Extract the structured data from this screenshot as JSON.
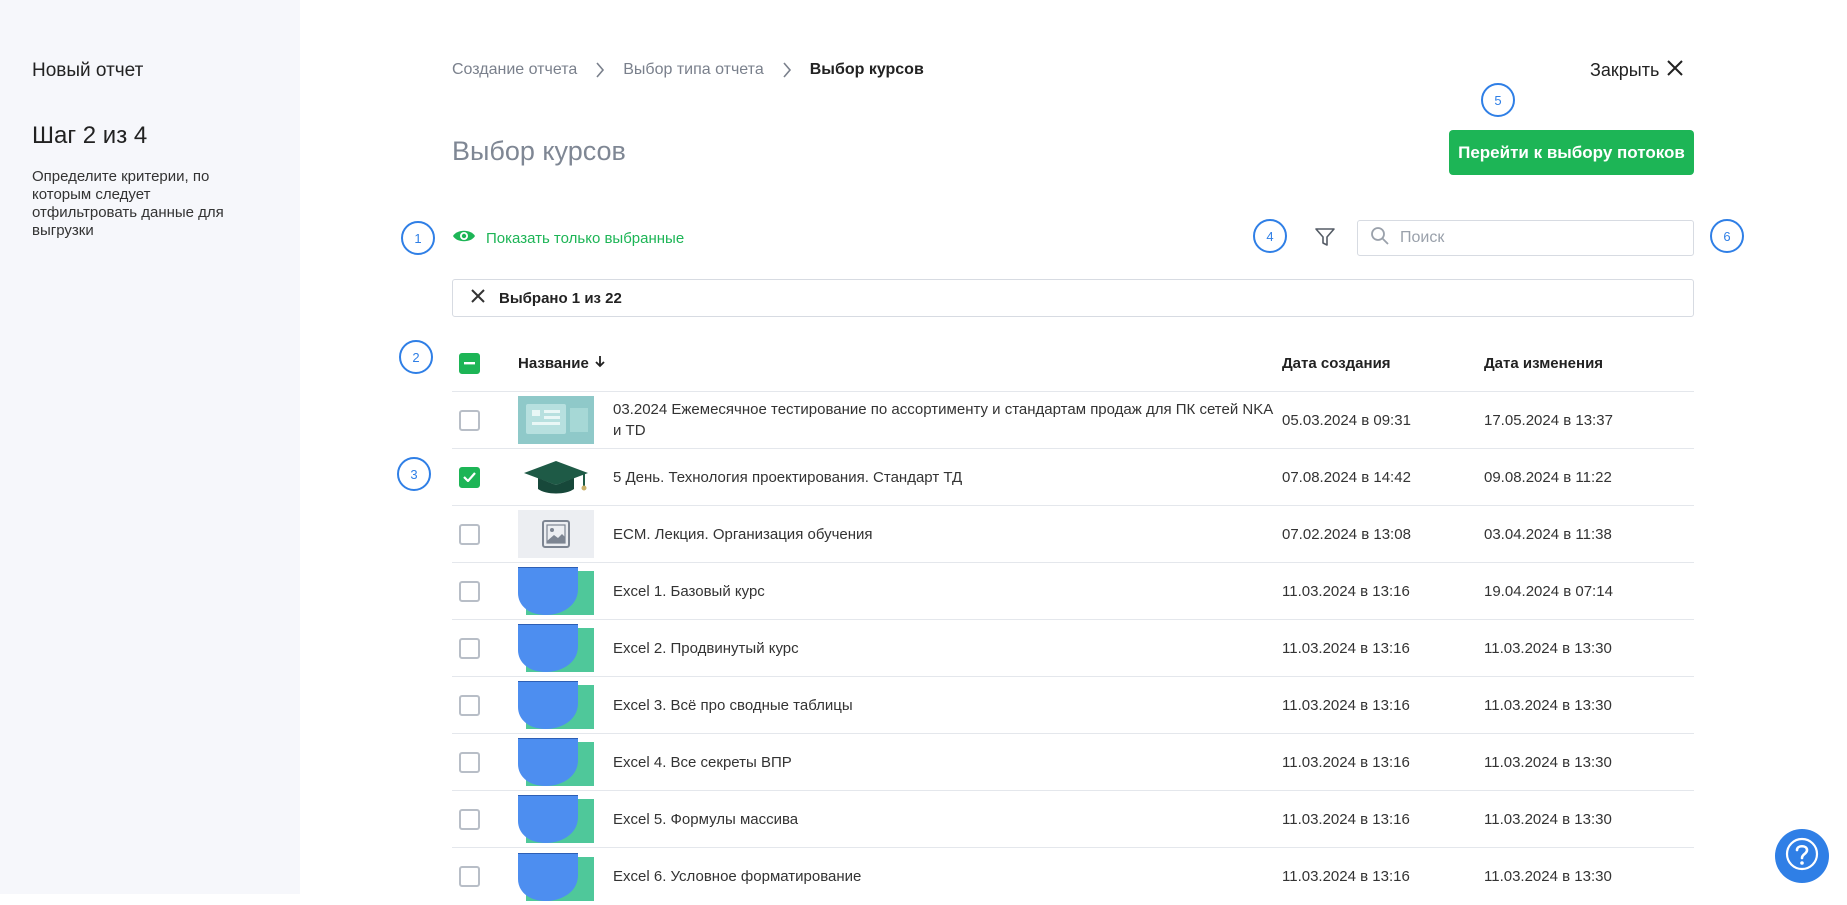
{
  "sidebar": {
    "title": "Новый отчет",
    "step": "Шаг 2 из 4",
    "description": "Определите критерии, по которым следует отфильтровать данные для выгрузки"
  },
  "breadcrumb": {
    "items": [
      "Создание отчета",
      "Выбор типа отчета",
      "Выбор курсов"
    ]
  },
  "header": {
    "close_label": "Закрыть",
    "title": "Выбор курсов",
    "primary_button": "Перейти к выбору потоков"
  },
  "toolbar": {
    "show_selected_label": "Показать только выбранные",
    "search_placeholder": "Поиск",
    "search_value": ""
  },
  "selection": {
    "label": "Выбрано 1 из 22"
  },
  "markers": [
    "1",
    "2",
    "3",
    "4",
    "5",
    "6"
  ],
  "table": {
    "columns": [
      "Название",
      "Дата создания",
      "Дата изменения"
    ],
    "rows": [
      {
        "name": "03.2024 Ежемесячное тестирование по ассортименту и стандартам продаж для ПК сетей NKA и TD",
        "created": "05.03.2024 в 09:31",
        "updated": "17.05.2024 в 13:37",
        "checked": false,
        "thumb": "slides"
      },
      {
        "name": "5 День. Технология проектирования. Стандарт ТД",
        "created": "07.08.2024 в 14:42",
        "updated": "09.08.2024 в 11:22",
        "checked": true,
        "thumb": "graduation-cap"
      },
      {
        "name": "ECM. Лекция. Организация обучения",
        "created": "07.02.2024 в 13:08",
        "updated": "03.04.2024 в 11:38",
        "checked": false,
        "thumb": "image-placeholder"
      },
      {
        "name": "Excel 1. Базовый курс",
        "created": "11.03.2024 в 13:16",
        "updated": "19.04.2024 в 07:14",
        "checked": false,
        "thumb": "excel"
      },
      {
        "name": "Excel 2. Продвинутый курс",
        "created": "11.03.2024 в 13:16",
        "updated": "11.03.2024 в 13:30",
        "checked": false,
        "thumb": "excel"
      },
      {
        "name": "Excel 3. Всё про сводные таблицы",
        "created": "11.03.2024 в 13:16",
        "updated": "11.03.2024 в 13:30",
        "checked": false,
        "thumb": "excel"
      },
      {
        "name": "Excel 4. Все секреты ВПР",
        "created": "11.03.2024 в 13:16",
        "updated": "11.03.2024 в 13:30",
        "checked": false,
        "thumb": "excel"
      },
      {
        "name": "Excel 5. Формулы массива",
        "created": "11.03.2024 в 13:16",
        "updated": "11.03.2024 в 13:30",
        "checked": false,
        "thumb": "excel"
      },
      {
        "name": "Excel 6. Условное форматирование",
        "created": "11.03.2024 в 13:16",
        "updated": "11.03.2024 в 13:30",
        "checked": false,
        "thumb": "excel"
      }
    ]
  },
  "colors": {
    "accent_green": "#1db556",
    "marker_blue": "#2f7fe6",
    "sidebar_bg": "#f6f7fb"
  }
}
